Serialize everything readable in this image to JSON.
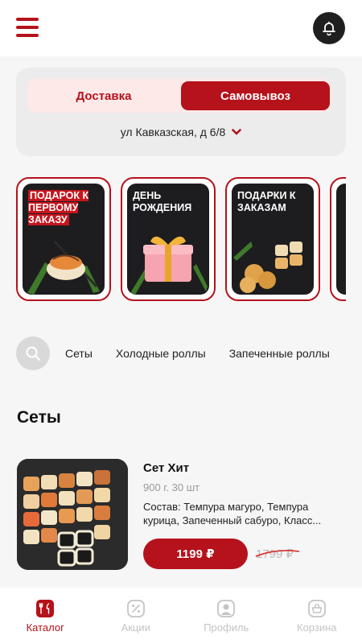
{
  "header": {
    "menu_icon": "menu-icon",
    "notify_icon": "bell-icon"
  },
  "delivery": {
    "options": [
      "Доставка",
      "Самовывоз"
    ],
    "selected": "Самовывоз",
    "address": "ул Кавказская, д 6/8"
  },
  "promos": [
    {
      "title": "Подарок к первому заказу"
    },
    {
      "title": "День рождения"
    },
    {
      "title": "Подарки к заказам"
    }
  ],
  "categories": {
    "items": [
      "Сеты",
      "Холодные роллы",
      "Запеченные роллы"
    ]
  },
  "section": {
    "title": "Сеты"
  },
  "product": {
    "name": "Сет Хит",
    "weight": "900 г. 30 шт",
    "description": "Состав: Темпура магуро, Темпура курица, Запеченный сабуро, Класс...",
    "price": "1199 ₽",
    "old_price": "1799 ₽"
  },
  "tabbar": {
    "items": [
      {
        "label": "Каталог",
        "icon": "catalog-icon",
        "active": true
      },
      {
        "label": "Акции",
        "icon": "percent-icon",
        "active": false
      },
      {
        "label": "Профиль",
        "icon": "profile-icon",
        "active": false
      },
      {
        "label": "Корзина",
        "icon": "basket-icon",
        "active": false
      }
    ]
  },
  "colors": {
    "accent": "#b5121b",
    "toggle_bg": "#fde9e8",
    "card_bg": "#ececec",
    "inactive": "#c4c4c4"
  }
}
